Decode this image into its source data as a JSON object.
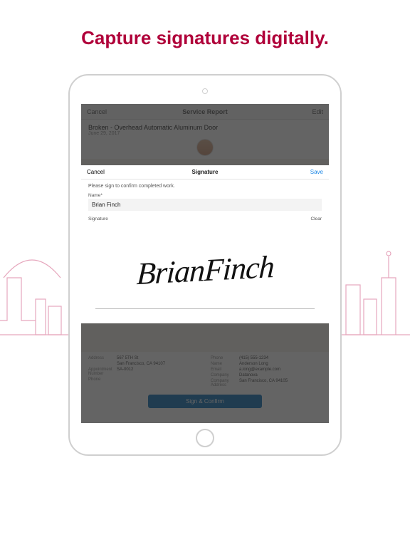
{
  "headline": "Capture signatures digitally.",
  "background_app": {
    "top_cancel": "Cancel",
    "top_title": "Service Report",
    "top_edit": "Edit",
    "report_title": "Broken - Overhead Automatic Aluminum Door",
    "report_date": "June 29, 2017",
    "details_left": [
      {
        "label": "Address",
        "value": "567 5TH St"
      },
      {
        "label": "",
        "value": "San Francisco, CA 94107"
      },
      {
        "label": "Appointment Number",
        "value": "SA-0012"
      },
      {
        "label": "Phone",
        "value": ""
      }
    ],
    "details_right": [
      {
        "label": "Phone",
        "value": "(415) 555-1234"
      },
      {
        "label": "Name",
        "value": "Anderson Long"
      },
      {
        "label": "Email",
        "value": "a.long@example.com"
      },
      {
        "label": "Company",
        "value": "Datanova"
      },
      {
        "label": "Company Address",
        "value": "San Francisco, CA 94105"
      }
    ],
    "sign_button": "Sign & Confirm"
  },
  "modal": {
    "cancel": "Cancel",
    "title": "Signature",
    "save": "Save",
    "hint": "Please sign to confirm completed work.",
    "name_label": "Name*",
    "name_value": "Brian Finch",
    "sig_label": "Signature",
    "clear": "Clear",
    "signature_text": "BrianFinch"
  }
}
